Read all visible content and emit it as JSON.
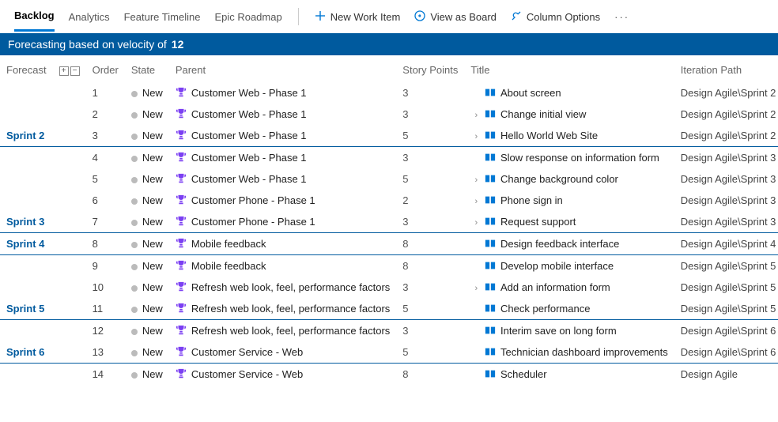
{
  "toolbar": {
    "tabs": [
      "Backlog",
      "Analytics",
      "Feature Timeline",
      "Epic Roadmap"
    ],
    "active_tab": 0,
    "buttons": {
      "new_item": "New Work Item",
      "view_board": "View as Board",
      "column_options": "Column Options"
    }
  },
  "info_bar": {
    "prefix": "Forecasting based on velocity of",
    "velocity": "12"
  },
  "columns": {
    "forecast": "Forecast",
    "order": "Order",
    "state": "State",
    "parent": "Parent",
    "story_points": "Story Points",
    "title": "Title",
    "iteration_path": "Iteration Path"
  },
  "rows": [
    {
      "forecast": "",
      "order": "1",
      "state": "New",
      "parent": "Customer Web - Phase 1",
      "sp": "3",
      "expander": false,
      "title": "About screen",
      "iter": "Design Agile\\Sprint 2",
      "band_end": false
    },
    {
      "forecast": "",
      "order": "2",
      "state": "New",
      "parent": "Customer Web - Phase 1",
      "sp": "3",
      "expander": true,
      "title": "Change initial view",
      "iter": "Design Agile\\Sprint 2",
      "band_end": false
    },
    {
      "forecast": "Sprint 2",
      "order": "3",
      "state": "New",
      "parent": "Customer Web - Phase 1",
      "sp": "5",
      "expander": true,
      "title": "Hello World Web Site",
      "iter": "Design Agile\\Sprint 2",
      "band_end": true
    },
    {
      "forecast": "",
      "order": "4",
      "state": "New",
      "parent": "Customer Web - Phase 1",
      "sp": "3",
      "expander": false,
      "title": "Slow response on information form",
      "iter": "Design Agile\\Sprint 3",
      "band_end": false
    },
    {
      "forecast": "",
      "order": "5",
      "state": "New",
      "parent": "Customer Web - Phase 1",
      "sp": "5",
      "expander": true,
      "title": "Change background color",
      "iter": "Design Agile\\Sprint 3",
      "band_end": false
    },
    {
      "forecast": "",
      "order": "6",
      "state": "New",
      "parent": "Customer Phone - Phase 1",
      "sp": "2",
      "expander": true,
      "title": "Phone sign in",
      "iter": "Design Agile\\Sprint 3",
      "band_end": false
    },
    {
      "forecast": "Sprint 3",
      "order": "7",
      "state": "New",
      "parent": "Customer Phone - Phase 1",
      "sp": "3",
      "expander": true,
      "title": "Request support",
      "iter": "Design Agile\\Sprint 3",
      "band_end": true
    },
    {
      "forecast": "Sprint 4",
      "order": "8",
      "state": "New",
      "parent": "Mobile feedback",
      "sp": "8",
      "expander": false,
      "title": "Design feedback interface",
      "iter": "Design Agile\\Sprint 4",
      "band_end": true
    },
    {
      "forecast": "",
      "order": "9",
      "state": "New",
      "parent": "Mobile feedback",
      "sp": "8",
      "expander": false,
      "title": "Develop mobile interface",
      "iter": "Design Agile\\Sprint 5",
      "band_end": false
    },
    {
      "forecast": "",
      "order": "10",
      "state": "New",
      "parent": "Refresh web look, feel, performance factors",
      "sp": "3",
      "expander": true,
      "title": "Add an information form",
      "iter": "Design Agile\\Sprint 5",
      "band_end": false
    },
    {
      "forecast": "Sprint 5",
      "order": "11",
      "state": "New",
      "parent": "Refresh web look, feel, performance factors",
      "sp": "5",
      "expander": false,
      "title": "Check performance",
      "iter": "Design Agile\\Sprint 5",
      "band_end": true
    },
    {
      "forecast": "",
      "order": "12",
      "state": "New",
      "parent": "Refresh web look, feel, performance factors",
      "sp": "3",
      "expander": false,
      "title": "Interim save on long form",
      "iter": "Design Agile\\Sprint 6",
      "band_end": false
    },
    {
      "forecast": "Sprint 6",
      "order": "13",
      "state": "New",
      "parent": "Customer Service - Web",
      "sp": "5",
      "expander": false,
      "title": "Technician dashboard improvements",
      "iter": "Design Agile\\Sprint 6",
      "band_end": true
    },
    {
      "forecast": "",
      "order": "14",
      "state": "New",
      "parent": "Customer Service - Web",
      "sp": "8",
      "expander": false,
      "title": "Scheduler",
      "iter": "Design Agile",
      "band_end": false
    }
  ]
}
